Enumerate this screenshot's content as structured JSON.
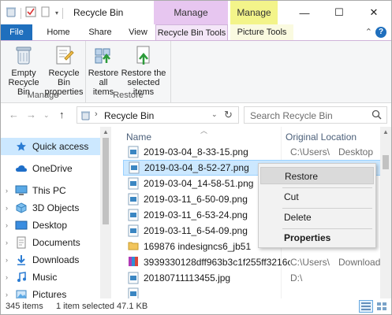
{
  "window": {
    "title": "Recycle Bin",
    "contextual_tabs": {
      "manage_left": "Manage",
      "manage_right": "Manage"
    },
    "controls": {
      "minimize": "—",
      "maximize": "☐",
      "close": "✕"
    }
  },
  "ribbon_tabs": [
    "File",
    "Home",
    "Share",
    "View",
    "Recycle Bin Tools",
    "Picture Tools"
  ],
  "ribbon": {
    "manage_group": {
      "label": "Manage",
      "empty_label": "Empty\nRecycle Bin",
      "props_label": "Recycle Bin\nproperties"
    },
    "restore_group": {
      "label": "Restore",
      "restore_all_label": "Restore\nall items",
      "restore_selected_label": "Restore the\nselected items"
    }
  },
  "address": {
    "path": "Recycle Bin",
    "search_placeholder": "Search Recycle Bin"
  },
  "nav": {
    "items": [
      "Quick access",
      "OneDrive",
      "This PC",
      "3D Objects",
      "Desktop",
      "Documents",
      "Downloads",
      "Music",
      "Pictures"
    ]
  },
  "list": {
    "headers": {
      "name": "Name",
      "location": "Original Location"
    },
    "rows": [
      {
        "name": "2019-03-04_8-33-15.png",
        "loc": "C:\\Users\\",
        "loc2": "Desktop"
      },
      {
        "name": "2019-03-04_8-52-27.png",
        "loc": "",
        "loc2": ""
      },
      {
        "name": "2019-03-04_14-58-51.png",
        "loc": "",
        "loc2": ""
      },
      {
        "name": "2019-03-11_6-50-09.png",
        "loc": "",
        "loc2": ""
      },
      {
        "name": "2019-03-11_6-53-24.png",
        "loc": "",
        "loc2": ""
      },
      {
        "name": "2019-03-11_6-54-09.png",
        "loc": "",
        "loc2": ""
      },
      {
        "name": "169876 indesigncs6_jb51",
        "loc": "",
        "loc2": ""
      },
      {
        "name": "3939330128dff963b3c1f255ff3216c...",
        "loc": "C:\\Users\\",
        "loc2": "Download"
      },
      {
        "name": "20180711113455.jpg",
        "loc": "D:\\",
        "loc2": ""
      },
      {
        "name": "",
        "loc": "",
        "loc2": ""
      }
    ]
  },
  "context_menu": {
    "restore": "Restore",
    "cut": "Cut",
    "delete": "Delete",
    "properties": "Properties"
  },
  "status": {
    "count": "345 items",
    "selected": "1 item selected  47.1 KB"
  },
  "colors": {
    "accent": "#1f6fbd",
    "selection": "#cce8ff",
    "manage_purple": "#e7c6f0",
    "manage_yellow": "#f3f48a"
  }
}
